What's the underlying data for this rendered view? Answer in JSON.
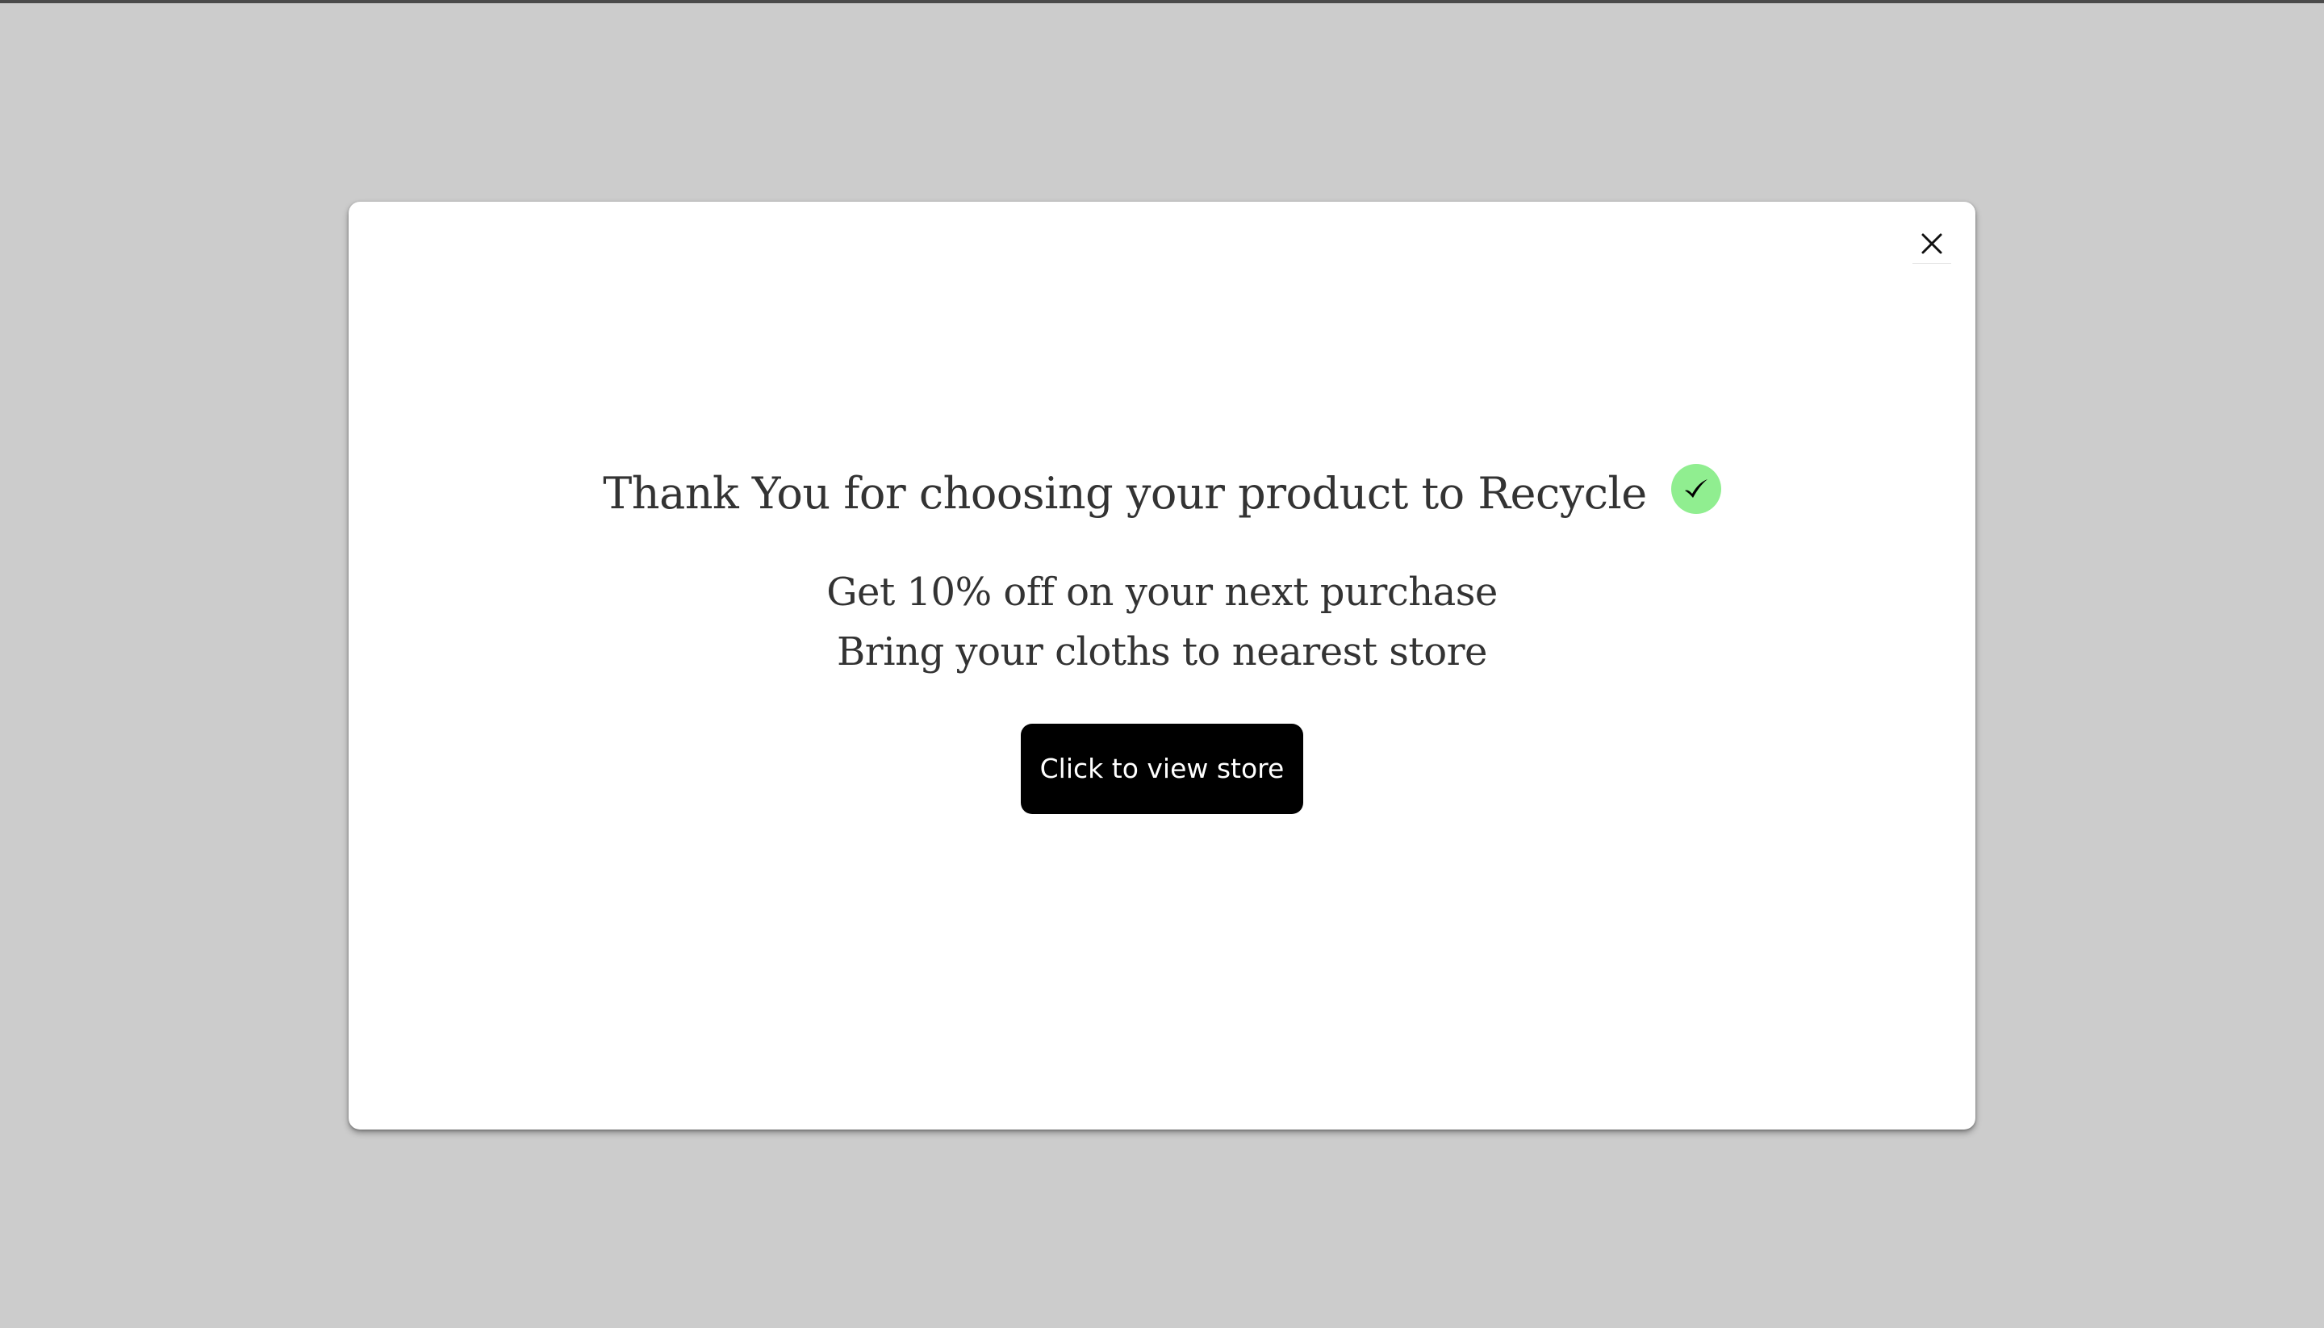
{
  "colors": {
    "backdrop": "#cccccc",
    "modal_bg": "#ffffff",
    "title_text": "#333333",
    "check_badge": "#90ee90",
    "check_mark": "#000000",
    "button_bg": "#000000",
    "button_text": "#ffffff"
  },
  "modal": {
    "close_icon": "close-icon",
    "title": "Thank You for choosing your product to Recycle",
    "title_icon": "check-circle-icon",
    "lines": [
      "Get 10% off on your next purchase",
      "Bring your cloths to nearest store"
    ],
    "button_label": "Click to view store"
  }
}
